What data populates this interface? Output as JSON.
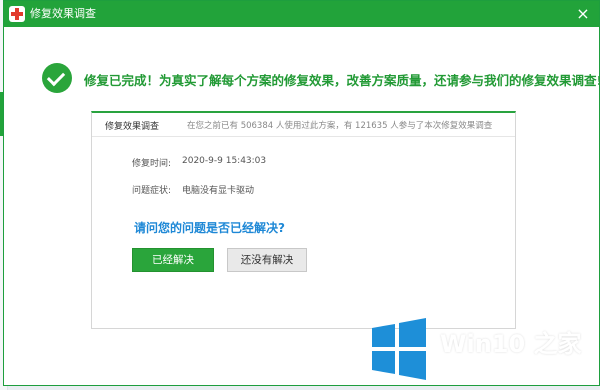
{
  "window": {
    "title": "修复效果调查",
    "close_glyph": "×"
  },
  "headline": "修复已完成！为真实了解每个方案的修复效果，改善方案质量，还请参与我们的修复效果调查!",
  "panel": {
    "title": "修复效果调查",
    "stats": "在您之前已有 506384 人使用过此方案，有 121635 人参与了本次修复效果调查",
    "repair_time_label": "修复时间:",
    "repair_time_value": "2020-9-9 15:43:03",
    "symptom_label": "问题症状:",
    "symptom_value": "电脑没有显卡驱动",
    "question": "请问您的问题是否已经解决?",
    "yes_button": "已经解决",
    "no_button": "还没有解决"
  },
  "watermark": {
    "title": "Win10 之家",
    "url": "www.win10xitong.com"
  },
  "colors": {
    "accent_green": "#22a33a",
    "question_blue": "#1e88d6",
    "windows_blue": "#1e8fd8"
  },
  "icons": [
    "app-icon",
    "close-icon",
    "success-check-icon",
    "windows-logo-icon"
  ]
}
